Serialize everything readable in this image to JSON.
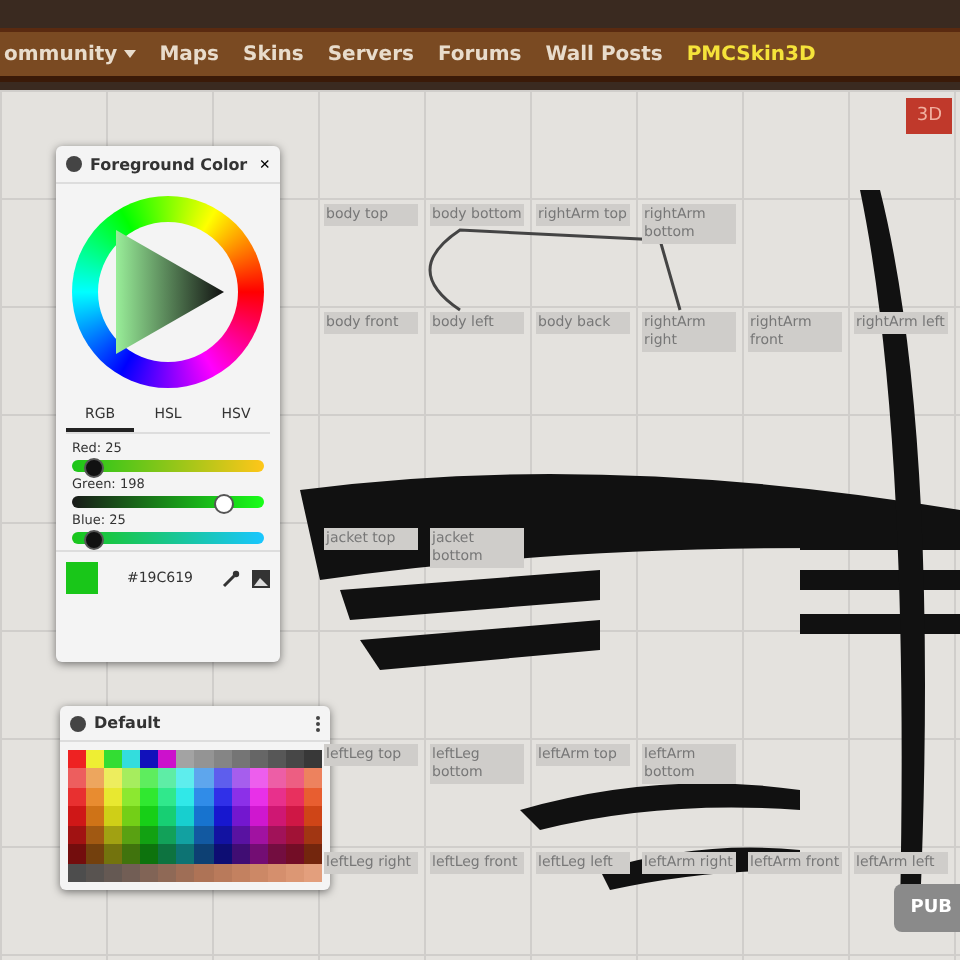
{
  "nav": {
    "items": [
      {
        "label": "ommunity",
        "kind": "dropdown",
        "selected": false
      },
      {
        "label": "Maps",
        "kind": "link",
        "selected": false
      },
      {
        "label": "Skins",
        "kind": "link",
        "selected": false
      },
      {
        "label": "Servers",
        "kind": "link",
        "selected": false
      },
      {
        "label": "Forums",
        "kind": "link",
        "selected": false
      },
      {
        "label": "Wall Posts",
        "kind": "link",
        "selected": false
      },
      {
        "label": "PMCSkin3D",
        "kind": "link",
        "selected": true
      }
    ]
  },
  "canvas": {
    "tile_rows": [
      [
        "body top",
        "body bottom",
        "rightArm top",
        "rightArm bottom"
      ],
      [
        "body front",
        "body left",
        "body back",
        "rightArm right",
        "rightArm front",
        "rightArm left"
      ],
      [
        "jacket top",
        "jacket bottom"
      ],
      [
        "leftLeg top",
        "leftLeg bottom",
        "leftArm top",
        "leftArm bottom"
      ],
      [
        "leftLeg right",
        "leftLeg front",
        "leftLeg left",
        "leftArm right",
        "leftArm front",
        "leftArm left"
      ]
    ],
    "view_button": "3D",
    "publish_button": "PUB"
  },
  "color_panel": {
    "title": "Foreground Color",
    "close": "×",
    "tabs": [
      {
        "label": "RGB",
        "selected": true
      },
      {
        "label": "HSL",
        "selected": false
      },
      {
        "label": "HSV",
        "selected": false
      }
    ],
    "sliders": [
      {
        "label": "Red: 25",
        "level": 0.1
      },
      {
        "label": "Green: 198",
        "level": 0.78
      },
      {
        "label": "Blue: 25",
        "level": 0.1
      }
    ],
    "swatch": {
      "color": "#19c619"
    },
    "hex": "#19C619"
  },
  "palette": {
    "title": "Default"
  }
}
